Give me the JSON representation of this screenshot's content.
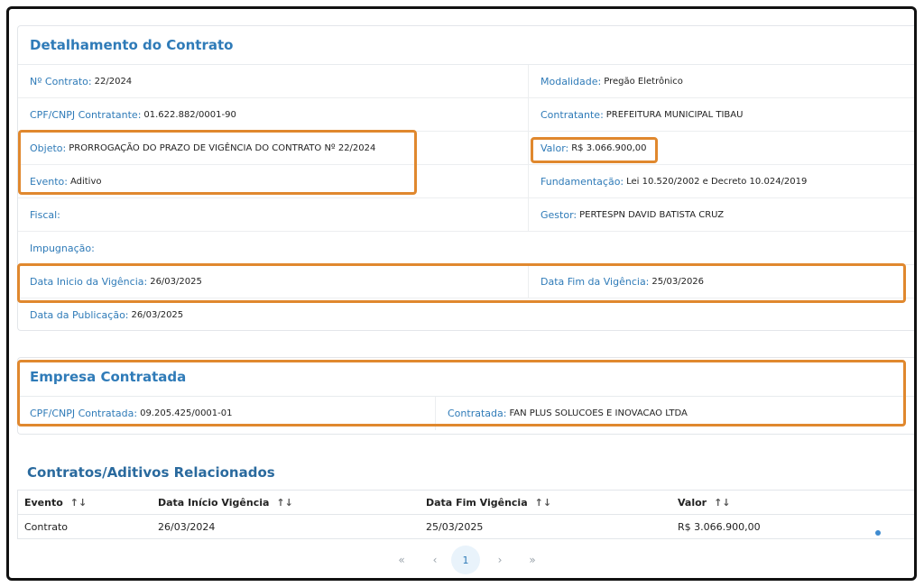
{
  "contract": {
    "title": "Detalhamento do Contrato",
    "rows": [
      {
        "left": {
          "label": "Nº Contrato:",
          "value": "22/2024"
        },
        "right": {
          "label": "Modalidade:",
          "value": "Pregão Eletrônico"
        }
      },
      {
        "left": {
          "label": "CPF/CNPJ Contratante:",
          "value": "01.622.882/0001-90"
        },
        "right": {
          "label": "Contratante:",
          "value": "PREFEITURA MUNICIPAL TIBAU"
        }
      },
      {
        "left": {
          "label": "Objeto:",
          "value": "PRORROGAÇÃO DO PRAZO DE VIGÊNCIA DO CONTRATO Nº 22/2024"
        },
        "right": {
          "label": "Valor:",
          "value": "R$ 3.066.900,00"
        }
      },
      {
        "left": {
          "label": "Evento:",
          "value": "Aditivo"
        },
        "right": {
          "label": "Fundamentação:",
          "value": "Lei 10.520/2002 e Decreto 10.024/2019"
        }
      },
      {
        "left": {
          "label": "Fiscal:",
          "value": ""
        },
        "right": {
          "label": "Gestor:",
          "value": "PERTESPN DAVID BATISTA CRUZ"
        }
      },
      {
        "full": {
          "label": "Impugnação:",
          "value": ""
        }
      },
      {
        "left": {
          "label": "Data Inicio da Vigência:",
          "value": "26/03/2025"
        },
        "right": {
          "label": "Data Fim da Vigência:",
          "value": "25/03/2026"
        }
      },
      {
        "full": {
          "label": "Data da Publicação:",
          "value": "26/03/2025"
        }
      }
    ]
  },
  "company": {
    "title": "Empresa Contratada",
    "cnpj_label": "CPF/CNPJ Contratada:",
    "cnpj_value": "09.205.425/0001-01",
    "name_label": "Contratada:",
    "name_value": "FAN PLUS SOLUCOES E INOVACAO LTDA"
  },
  "related": {
    "title": "Contratos/Aditivos Relacionados",
    "columns": [
      "Evento",
      "Data Início Vigência",
      "Data Fim Vigência",
      "Valor"
    ],
    "sort_icon": "sort-updown-icon",
    "rows": [
      [
        "Contrato",
        "26/03/2024",
        "25/03/2025",
        "R$ 3.066.900,00"
      ]
    ]
  },
  "pagination": {
    "first": "«",
    "prev": "‹",
    "current": "1",
    "next": "›",
    "last": "»"
  },
  "colors": {
    "accent": "#2f7bb8",
    "highlight": "#e0882e"
  }
}
